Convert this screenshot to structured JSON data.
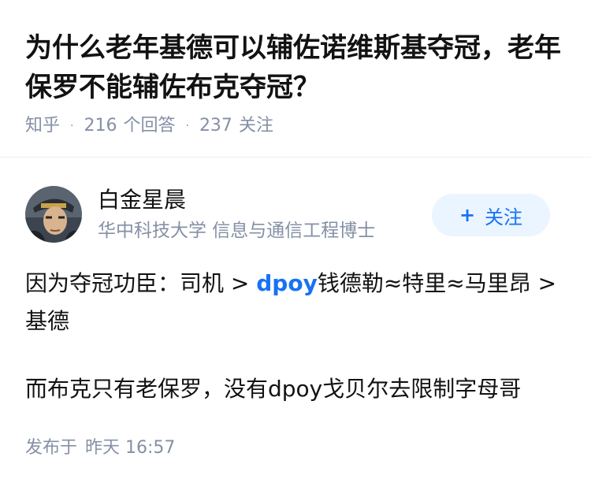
{
  "question": {
    "title": "为什么老年基德可以辅佐诺维斯基夺冠，老年保罗不能辅佐布克夺冠？",
    "source": "知乎",
    "answer_count": "216",
    "answer_label": "个回答",
    "follower_count": "237",
    "follower_label": "关注"
  },
  "author": {
    "name": "白金星晨",
    "bio": "华中科技大学 信息与通信工程博士",
    "follow_label": "关注",
    "follow_icon": "plus-icon",
    "avatar": "avatar-image"
  },
  "answer": {
    "p1_before": "因为夺冠功臣：司机 > ",
    "p1_link": "dpoy",
    "p1_after": "钱德勒≈特里≈马里昂 > 基德",
    "p2": "而布克只有老保罗，没有dpoy戈贝尔去限制字母哥"
  },
  "footer": {
    "published_label": "发布于",
    "published_time": "昨天 16:57"
  },
  "colors": {
    "accent": "#1772f6",
    "meta": "#8590a6",
    "button_bg": "#ebf5ff"
  }
}
